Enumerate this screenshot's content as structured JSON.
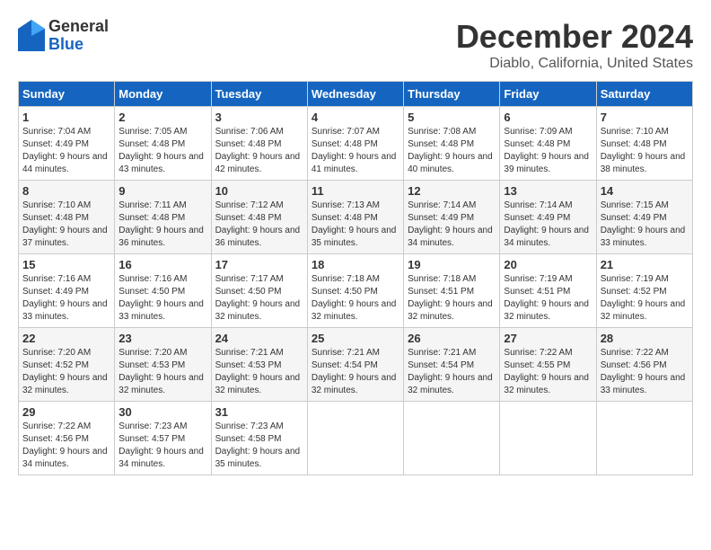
{
  "header": {
    "logo_line1": "General",
    "logo_line2": "Blue",
    "month": "December 2024",
    "location": "Diablo, California, United States"
  },
  "weekdays": [
    "Sunday",
    "Monday",
    "Tuesday",
    "Wednesday",
    "Thursday",
    "Friday",
    "Saturday"
  ],
  "weeks": [
    [
      {
        "day": "1",
        "sunrise": "7:04 AM",
        "sunset": "4:49 PM",
        "daylight": "9 hours and 44 minutes."
      },
      {
        "day": "2",
        "sunrise": "7:05 AM",
        "sunset": "4:48 PM",
        "daylight": "9 hours and 43 minutes."
      },
      {
        "day": "3",
        "sunrise": "7:06 AM",
        "sunset": "4:48 PM",
        "daylight": "9 hours and 42 minutes."
      },
      {
        "day": "4",
        "sunrise": "7:07 AM",
        "sunset": "4:48 PM",
        "daylight": "9 hours and 41 minutes."
      },
      {
        "day": "5",
        "sunrise": "7:08 AM",
        "sunset": "4:48 PM",
        "daylight": "9 hours and 40 minutes."
      },
      {
        "day": "6",
        "sunrise": "7:09 AM",
        "sunset": "4:48 PM",
        "daylight": "9 hours and 39 minutes."
      },
      {
        "day": "7",
        "sunrise": "7:10 AM",
        "sunset": "4:48 PM",
        "daylight": "9 hours and 38 minutes."
      }
    ],
    [
      {
        "day": "8",
        "sunrise": "7:10 AM",
        "sunset": "4:48 PM",
        "daylight": "9 hours and 37 minutes."
      },
      {
        "day": "9",
        "sunrise": "7:11 AM",
        "sunset": "4:48 PM",
        "daylight": "9 hours and 36 minutes."
      },
      {
        "day": "10",
        "sunrise": "7:12 AM",
        "sunset": "4:48 PM",
        "daylight": "9 hours and 36 minutes."
      },
      {
        "day": "11",
        "sunrise": "7:13 AM",
        "sunset": "4:48 PM",
        "daylight": "9 hours and 35 minutes."
      },
      {
        "day": "12",
        "sunrise": "7:14 AM",
        "sunset": "4:49 PM",
        "daylight": "9 hours and 34 minutes."
      },
      {
        "day": "13",
        "sunrise": "7:14 AM",
        "sunset": "4:49 PM",
        "daylight": "9 hours and 34 minutes."
      },
      {
        "day": "14",
        "sunrise": "7:15 AM",
        "sunset": "4:49 PM",
        "daylight": "9 hours and 33 minutes."
      }
    ],
    [
      {
        "day": "15",
        "sunrise": "7:16 AM",
        "sunset": "4:49 PM",
        "daylight": "9 hours and 33 minutes."
      },
      {
        "day": "16",
        "sunrise": "7:16 AM",
        "sunset": "4:50 PM",
        "daylight": "9 hours and 33 minutes."
      },
      {
        "day": "17",
        "sunrise": "7:17 AM",
        "sunset": "4:50 PM",
        "daylight": "9 hours and 32 minutes."
      },
      {
        "day": "18",
        "sunrise": "7:18 AM",
        "sunset": "4:50 PM",
        "daylight": "9 hours and 32 minutes."
      },
      {
        "day": "19",
        "sunrise": "7:18 AM",
        "sunset": "4:51 PM",
        "daylight": "9 hours and 32 minutes."
      },
      {
        "day": "20",
        "sunrise": "7:19 AM",
        "sunset": "4:51 PM",
        "daylight": "9 hours and 32 minutes."
      },
      {
        "day": "21",
        "sunrise": "7:19 AM",
        "sunset": "4:52 PM",
        "daylight": "9 hours and 32 minutes."
      }
    ],
    [
      {
        "day": "22",
        "sunrise": "7:20 AM",
        "sunset": "4:52 PM",
        "daylight": "9 hours and 32 minutes."
      },
      {
        "day": "23",
        "sunrise": "7:20 AM",
        "sunset": "4:53 PM",
        "daylight": "9 hours and 32 minutes."
      },
      {
        "day": "24",
        "sunrise": "7:21 AM",
        "sunset": "4:53 PM",
        "daylight": "9 hours and 32 minutes."
      },
      {
        "day": "25",
        "sunrise": "7:21 AM",
        "sunset": "4:54 PM",
        "daylight": "9 hours and 32 minutes."
      },
      {
        "day": "26",
        "sunrise": "7:21 AM",
        "sunset": "4:54 PM",
        "daylight": "9 hours and 32 minutes."
      },
      {
        "day": "27",
        "sunrise": "7:22 AM",
        "sunset": "4:55 PM",
        "daylight": "9 hours and 32 minutes."
      },
      {
        "day": "28",
        "sunrise": "7:22 AM",
        "sunset": "4:56 PM",
        "daylight": "9 hours and 33 minutes."
      }
    ],
    [
      {
        "day": "29",
        "sunrise": "7:22 AM",
        "sunset": "4:56 PM",
        "daylight": "9 hours and 34 minutes."
      },
      {
        "day": "30",
        "sunrise": "7:23 AM",
        "sunset": "4:57 PM",
        "daylight": "9 hours and 34 minutes."
      },
      {
        "day": "31",
        "sunrise": "7:23 AM",
        "sunset": "4:58 PM",
        "daylight": "9 hours and 35 minutes."
      },
      null,
      null,
      null,
      null
    ]
  ]
}
